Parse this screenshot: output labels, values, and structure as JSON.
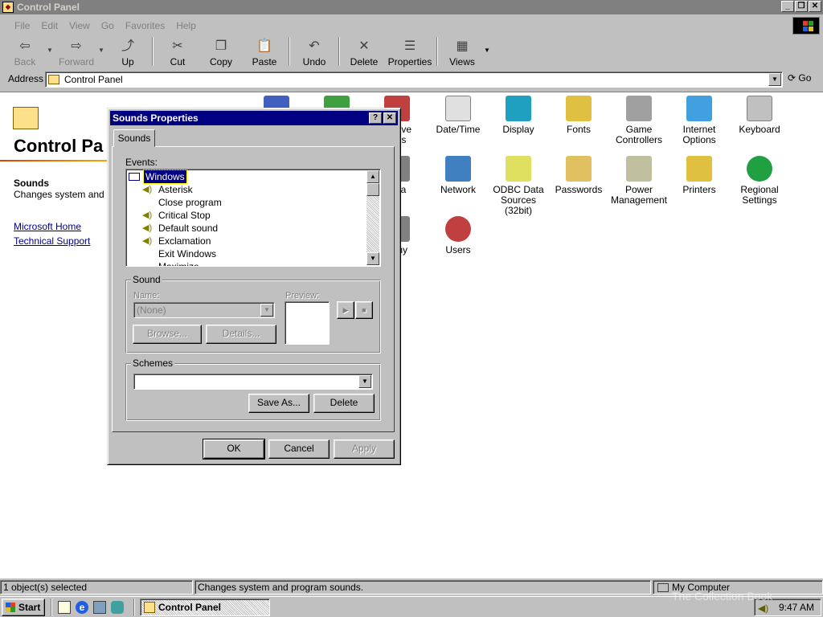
{
  "window": {
    "title": "Control Panel"
  },
  "menu": [
    "File",
    "Edit",
    "View",
    "Go",
    "Favorites",
    "Help"
  ],
  "toolbar": [
    {
      "label": "Back",
      "disabled": true,
      "icon": "back-arrow-icon",
      "glyph": "⇦"
    },
    {
      "label": "Forward",
      "disabled": true,
      "icon": "forward-arrow-icon",
      "glyph": "⇨"
    },
    {
      "label": "Up",
      "disabled": false,
      "icon": "up-folder-icon",
      "glyph": "⤴"
    },
    {
      "label": "Cut",
      "disabled": false,
      "icon": "scissors-icon",
      "glyph": "✂"
    },
    {
      "label": "Copy",
      "disabled": false,
      "icon": "copy-icon",
      "glyph": "❐"
    },
    {
      "label": "Paste",
      "disabled": false,
      "icon": "paste-icon",
      "glyph": "📋"
    },
    {
      "label": "Undo",
      "disabled": false,
      "icon": "undo-icon",
      "glyph": "↶"
    },
    {
      "label": "Delete",
      "disabled": false,
      "icon": "delete-x-icon",
      "glyph": "✕"
    },
    {
      "label": "Properties",
      "disabled": false,
      "icon": "properties-icon",
      "glyph": "☰"
    },
    {
      "label": "Views",
      "disabled": false,
      "icon": "views-icon",
      "glyph": "▦"
    }
  ],
  "address": {
    "label": "Address",
    "value": "Control Panel",
    "go": "Go"
  },
  "left_pane": {
    "heading": "Control Pa",
    "item_title": "Sounds",
    "item_desc": "Changes system and",
    "links": [
      "Microsoft Home",
      "Technical Support"
    ]
  },
  "icons": [
    {
      "label": "",
      "color": "#4060c0",
      "name": "partial-icon-1"
    },
    {
      "label": "",
      "color": "#40a040",
      "name": "partial-icon-2"
    },
    {
      "label": "emove\nams",
      "color": "#c04040",
      "name": "add-remove-programs-icon"
    },
    {
      "label": "Date/Time",
      "color": "#e0e0e0",
      "name": "date-time-icon"
    },
    {
      "label": "Display",
      "color": "#20a0c0",
      "name": "display-icon"
    },
    {
      "label": "Fonts",
      "color": "#e0c040",
      "name": "fonts-icon"
    },
    {
      "label": "Game\nControllers",
      "color": "#a0a0a0",
      "name": "game-controllers-icon"
    },
    {
      "label": "Internet\nOptions",
      "color": "#40a0e0",
      "name": "internet-options-icon"
    },
    {
      "label": "Keyboard",
      "color": "#c0c0c0",
      "name": "keyboard-icon"
    },
    {
      "label": "edia",
      "color": "#808080",
      "name": "multimedia-icon"
    },
    {
      "label": "Network",
      "color": "#4080c0",
      "name": "network-icon"
    },
    {
      "label": "ODBC Data\nSources (32bit)",
      "color": "#e0e060",
      "name": "odbc-icon"
    },
    {
      "label": "Passwords",
      "color": "#e0c060",
      "name": "passwords-icon"
    },
    {
      "label": "Power\nManagement",
      "color": "#c0c0a0",
      "name": "power-management-icon"
    },
    {
      "label": "Printers",
      "color": "#e0c040",
      "name": "printers-icon"
    },
    {
      "label": "Regional\nSettings",
      "color": "#20a040",
      "name": "regional-settings-icon"
    },
    {
      "label": "hony",
      "color": "#808080",
      "name": "telephony-icon"
    },
    {
      "label": "Users",
      "color": "#c04040",
      "name": "users-icon"
    }
  ],
  "dialog": {
    "title": "Sounds Properties",
    "tab": "Sounds",
    "events_label": "Events:",
    "events": [
      {
        "label": "Windows",
        "icon": "windows-icon",
        "selected": true,
        "indent": false
      },
      {
        "label": "Asterisk",
        "icon": "speaker-icon",
        "indent": true
      },
      {
        "label": "Close program",
        "icon": "",
        "indent": true
      },
      {
        "label": "Critical Stop",
        "icon": "speaker-icon",
        "indent": true
      },
      {
        "label": "Default sound",
        "icon": "speaker-icon",
        "indent": true
      },
      {
        "label": "Exclamation",
        "icon": "speaker-icon",
        "indent": true
      },
      {
        "label": "Exit Windows",
        "icon": "",
        "indent": true
      },
      {
        "label": "Maximize",
        "icon": "",
        "indent": true
      }
    ],
    "sound_group": "Sound",
    "name_label": "Name:",
    "name_value": "(None)",
    "preview_label": "Preview:",
    "browse": "Browse...",
    "details": "Details...",
    "schemes_group": "Schemes",
    "schemes_value": "",
    "save_as": "Save As...",
    "delete": "Delete",
    "ok": "OK",
    "cancel": "Cancel",
    "apply": "Apply"
  },
  "status": {
    "selected": "1 object(s) selected",
    "desc": "Changes system and program sounds.",
    "zone": "My Computer"
  },
  "taskbar": {
    "start": "Start",
    "task": "Control Panel",
    "time": "9:47 AM"
  },
  "watermark": "The Collection Book"
}
